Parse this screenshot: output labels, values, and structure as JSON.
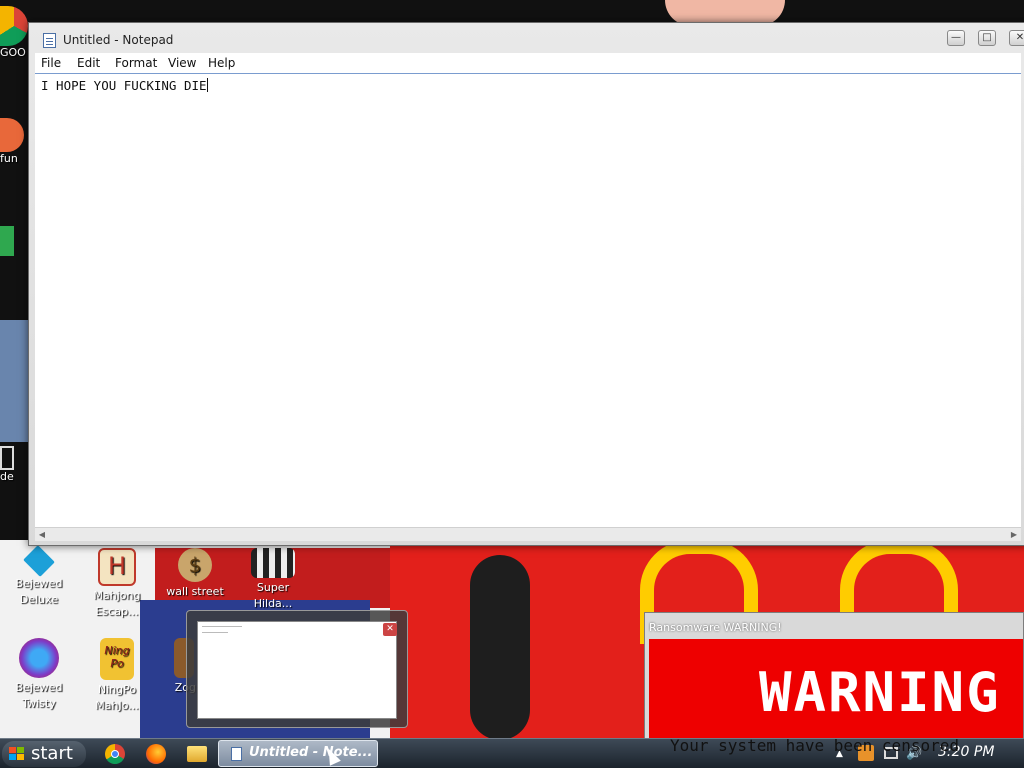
{
  "notepad": {
    "title": "Untitled - Notepad",
    "menu": [
      "File",
      "Edit",
      "Format",
      "View",
      "Help"
    ],
    "content": "I HOPE YOU FUCKING DIE",
    "min_glyph": "—",
    "max_glyph": "□",
    "close_glyph": "✕"
  },
  "desktop": {
    "icons": [
      {
        "name": "bejeweled-deluxe",
        "label": "Bejewed\nDeluxe",
        "color": "#1ca0d8"
      },
      {
        "name": "mahjong-escape",
        "label": "Mahjong\nEscap...",
        "color": "#c0392b"
      },
      {
        "name": "wall-street",
        "label": "wall street",
        "color": "#8a6d3b"
      },
      {
        "name": "super-hilda",
        "label": "Super Hilda...",
        "color": "#e6e6e6"
      },
      {
        "name": "bejeweled-twisty",
        "label": "Bejewed\nTwisty",
        "color": "#7d3cc8"
      },
      {
        "name": "ningpo-mahjong",
        "label": "NingPo\nMahJo...",
        "color": "#d9a400"
      },
      {
        "name": "zog",
        "label": "Zog",
        "color": "#8b5a2b"
      }
    ],
    "left_peek": [
      "GOO",
      "fun",
      "de"
    ],
    "icon_glyphs": {
      "mahjong": "H",
      "wallstreet": "$",
      "ningpo": "Ning Po"
    }
  },
  "ransomware": {
    "title": "Ransomware WARNING!",
    "heading": "WARNING",
    "message": "Your system have been censored"
  },
  "taskbar": {
    "start_label": "start",
    "active_task": "Untitled - Note...",
    "clock": "3:20 PM",
    "tray_icons": [
      "up-arrow",
      "flash-icon",
      "network-icon",
      "volume-icon"
    ],
    "tray_glyphs": [
      "▲",
      "🔊"
    ]
  },
  "colors": {
    "ransom_red": "#ee0000",
    "taskbar": "#2a333d",
    "selection_border": "#7a9ccf"
  }
}
